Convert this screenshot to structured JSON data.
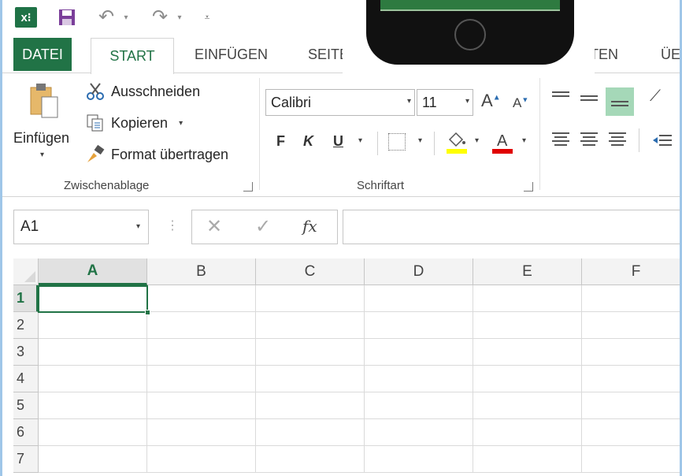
{
  "qat": {
    "excel_logo": "x⁝",
    "save": "save-icon",
    "undo": "↶",
    "redo": "↷",
    "dropdown": "▾",
    "customize": "⩡"
  },
  "tabs": {
    "datei": "DATEI",
    "start": "START",
    "einfuegen": "EINFÜGEN",
    "seite": "SEITE",
    "ten": "TEN",
    "ue": "ÜE"
  },
  "clipboard": {
    "paste_label": "Einfügen",
    "cut_label": "Ausschneiden",
    "copy_label": "Kopieren",
    "format_label": "Format übertragen",
    "group_label": "Zwischenablage"
  },
  "font": {
    "name": "Calibri",
    "size": "11",
    "grow": "A",
    "shrink": "A",
    "bold": "F",
    "italic": "K",
    "underline": "U",
    "group_label": "Schriftart"
  },
  "formula": {
    "namebox_value": "A1",
    "grip": "⋮",
    "cancel": "✕",
    "enter": "✓",
    "fx": "fx"
  },
  "grid": {
    "columns": [
      "A",
      "B",
      "C",
      "D",
      "E",
      "F"
    ],
    "rows": [
      "1",
      "2",
      "3",
      "4",
      "5",
      "6",
      "7"
    ]
  },
  "colors": {
    "accent": "#217346",
    "fill_highlight": "#ffff00",
    "font_color": "#e00000"
  }
}
